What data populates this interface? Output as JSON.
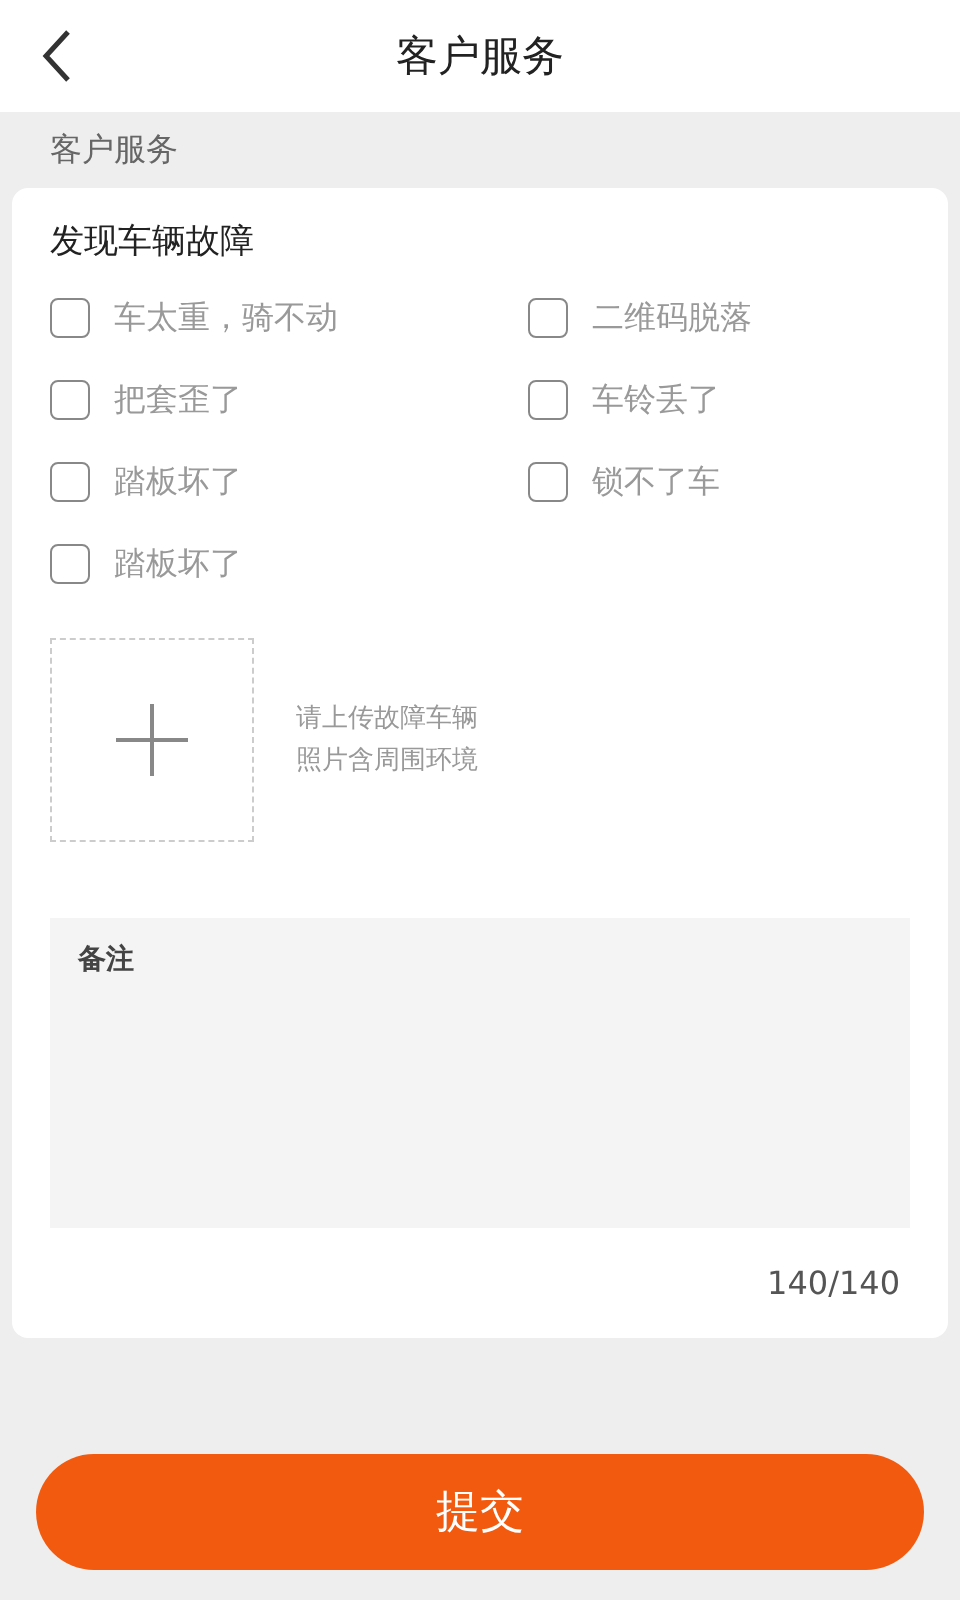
{
  "header": {
    "title": "客户服务"
  },
  "section_label": "客户服务",
  "card": {
    "title": "发现车辆故障",
    "options": [
      {
        "label": "车太重，骑不动",
        "checked": false
      },
      {
        "label": "二维码脱落",
        "checked": false
      },
      {
        "label": "把套歪了",
        "checked": false
      },
      {
        "label": "车铃丢了",
        "checked": false
      },
      {
        "label": "踏板坏了",
        "checked": false
      },
      {
        "label": "锁不了车",
        "checked": false
      },
      {
        "label": "踏板坏了",
        "checked": false
      }
    ],
    "upload_hint": [
      "请上传故障车辆",
      "照片含周围环境"
    ],
    "notes": {
      "label": "备注",
      "counter": "140/140"
    }
  },
  "submit": "提交"
}
